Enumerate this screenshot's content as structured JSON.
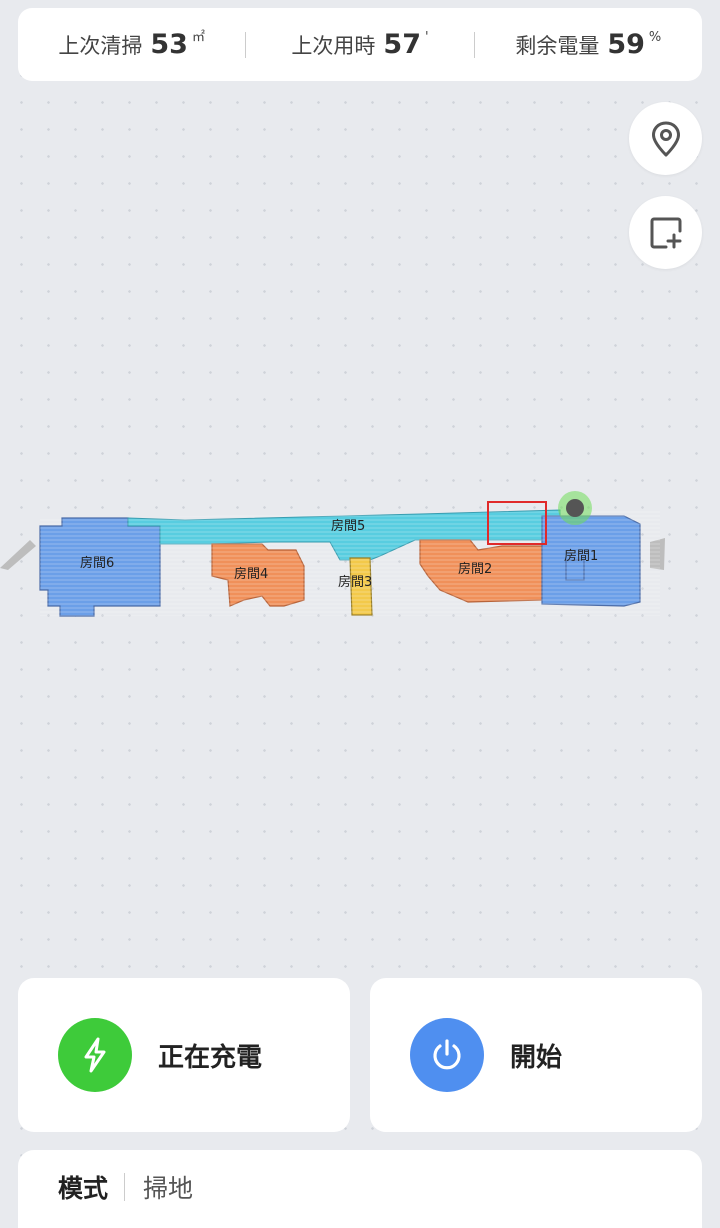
{
  "stats": [
    {
      "label": "上次清掃",
      "value": "53",
      "unit": "㎡"
    },
    {
      "label": "上次用時",
      "value": "57",
      "unit": "'"
    },
    {
      "label": "剩余電量",
      "value": "59",
      "unit": "%"
    }
  ],
  "side_buttons": {
    "locate_icon": "location-pin-icon",
    "add_zone_icon": "add-zone-icon"
  },
  "map": {
    "rooms": [
      {
        "name": "房間1"
      },
      {
        "name": "房間2"
      },
      {
        "name": "房間3"
      },
      {
        "name": "房間4"
      },
      {
        "name": "房間5"
      },
      {
        "name": "房間6"
      }
    ],
    "colors": {
      "blue": "#6b9fe8",
      "cyan": "#58cde0",
      "orange": "#f0905a",
      "yellow": "#f3c94a",
      "zone_outline": "#e02a2a",
      "robot_glow": "#6fdc5a"
    }
  },
  "actions": {
    "charging": {
      "label": "正在充電",
      "color": "#3ecb3a",
      "icon": "lightning-icon"
    },
    "start": {
      "label": "開始",
      "color": "#4f8ff0",
      "icon": "power-icon"
    }
  },
  "mode": {
    "label": "模式",
    "value": "掃地"
  }
}
